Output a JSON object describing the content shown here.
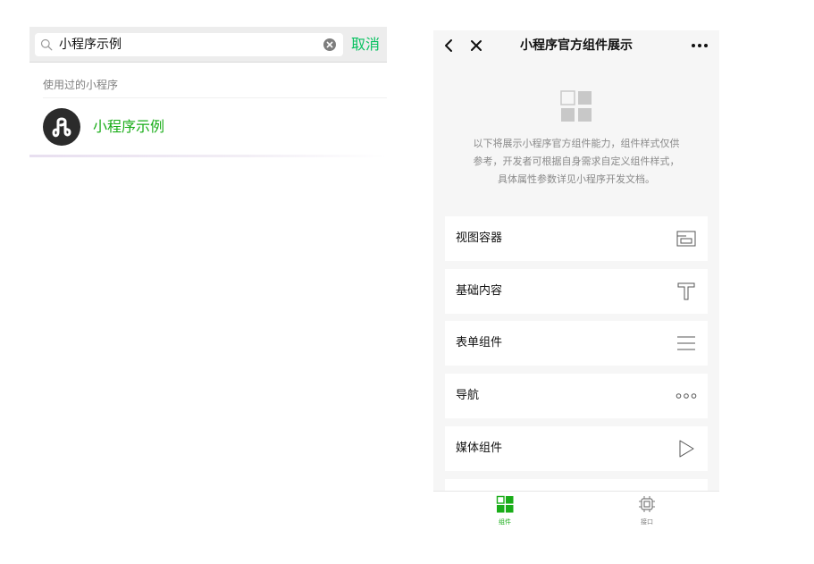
{
  "search": {
    "query": "小程序示例",
    "cancel_label": "取消",
    "section_label": "使用过的小程序",
    "result_name": "小程序示例"
  },
  "miniapp": {
    "title": "小程序官方组件展示",
    "intro_lines": [
      "以下将展示小程序官方组件能力，组件样式仅供",
      "参考，开发者可根据自身需求自定义组件样式，",
      "具体属性参数详见小程序开发文档。"
    ],
    "menu": [
      {
        "label": "视图容器",
        "icon": "view-container-icon"
      },
      {
        "label": "基础内容",
        "icon": "text-t-icon"
      },
      {
        "label": "表单组件",
        "icon": "form-lines-icon"
      },
      {
        "label": "导航",
        "icon": "navigation-dots-icon"
      },
      {
        "label": "媒体组件",
        "icon": "media-play-icon"
      }
    ],
    "tabs": [
      {
        "label": "组件",
        "icon": "components-grid-icon",
        "active": true
      },
      {
        "label": "接口",
        "icon": "api-chip-icon",
        "active": false
      }
    ]
  },
  "colors": {
    "accent_green": "#07c160",
    "result_green": "#1aad19",
    "tab_active": "#1aad19",
    "tab_inactive": "#7a7a7a"
  }
}
